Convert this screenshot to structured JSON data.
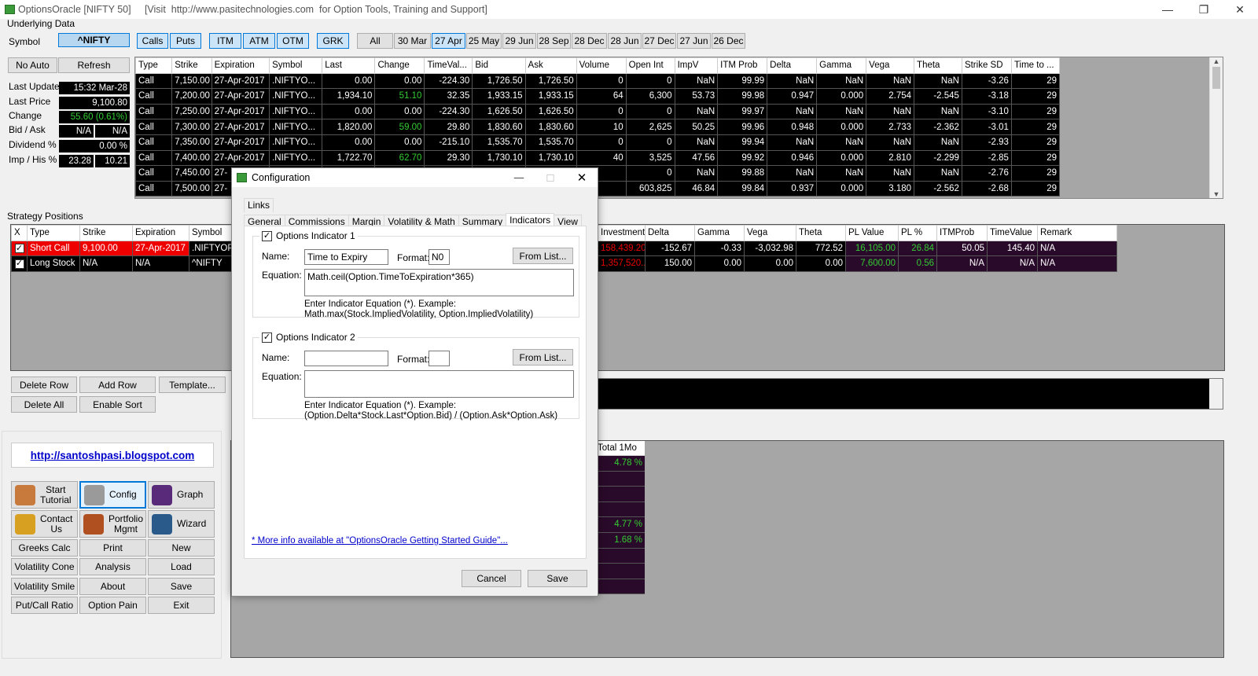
{
  "window": {
    "title": "OptionsOracle [NIFTY 50]     [Visit  http://www.pasitechnologies.com  for Option Tools, Training and Support]",
    "minimize": "—",
    "maximize": "❐",
    "close": "✕"
  },
  "underlying": {
    "section_title": "Underlying Data",
    "symbol_label": "Symbol",
    "symbol_value": "^NIFTY",
    "no_auto": "No Auto",
    "refresh": "Refresh",
    "fields": [
      {
        "label": "Last Update",
        "value": "15:32 Mar-28"
      },
      {
        "label": "Last Price",
        "value": "9,100.80"
      },
      {
        "label": "Change",
        "value": "55.60 (0.61%)"
      },
      {
        "label": "Bid / Ask",
        "value": "N/A",
        "value2": "N/A"
      },
      {
        "label": "Dividend %",
        "value": "0.00 %"
      },
      {
        "label": "Imp / His %",
        "value": "23.28",
        "value2": "10.21"
      }
    ]
  },
  "filters": {
    "calls": "Calls",
    "puts": "Puts",
    "itm": "ITM",
    "atm": "ATM",
    "otm": "OTM",
    "grk": "GRK",
    "dates": [
      "All",
      "30 Mar",
      "27 Apr",
      "25 May",
      "29 Jun",
      "28 Sep",
      "28 Dec",
      "28 Jun",
      "27 Dec",
      "27 Jun",
      "26 Dec"
    ]
  },
  "options_table": {
    "headers": [
      "Type",
      "Strike",
      "Expiration",
      "Symbol",
      "Last",
      "Change",
      "TimeVal...",
      "Bid",
      "Ask",
      "Volume",
      "Open Int",
      "ImpV",
      "ITM Prob",
      "Delta",
      "Gamma",
      "Vega",
      "Theta",
      "Strike SD",
      "Time to ..."
    ],
    "rows": [
      [
        "Call",
        "7,150.00",
        "27-Apr-2017",
        ".NIFTYO...",
        "0.00",
        "0.00",
        "-224.30",
        "1,726.50",
        "1,726.50",
        "0",
        "0",
        "NaN",
        "99.99",
        "NaN",
        "NaN",
        "NaN",
        "NaN",
        "-3.26",
        "29"
      ],
      [
        "Call",
        "7,200.00",
        "27-Apr-2017",
        ".NIFTYO...",
        "1,934.10",
        "51.10",
        "32.35",
        "1,933.15",
        "1,933.15",
        "64",
        "6,300",
        "53.73",
        "99.98",
        "0.947",
        "0.000",
        "2.754",
        "-2.545",
        "-3.18",
        "29"
      ],
      [
        "Call",
        "7,250.00",
        "27-Apr-2017",
        ".NIFTYO...",
        "0.00",
        "0.00",
        "-224.30",
        "1,626.50",
        "1,626.50",
        "0",
        "0",
        "NaN",
        "99.97",
        "NaN",
        "NaN",
        "NaN",
        "NaN",
        "-3.10",
        "29"
      ],
      [
        "Call",
        "7,300.00",
        "27-Apr-2017",
        ".NIFTYO...",
        "1,820.00",
        "59.00",
        "29.80",
        "1,830.60",
        "1,830.60",
        "10",
        "2,625",
        "50.25",
        "99.96",
        "0.948",
        "0.000",
        "2.733",
        "-2.362",
        "-3.01",
        "29"
      ],
      [
        "Call",
        "7,350.00",
        "27-Apr-2017",
        ".NIFTYO...",
        "0.00",
        "0.00",
        "-215.10",
        "1,535.70",
        "1,535.70",
        "0",
        "0",
        "NaN",
        "99.94",
        "NaN",
        "NaN",
        "NaN",
        "NaN",
        "-2.93",
        "29"
      ],
      [
        "Call",
        "7,400.00",
        "27-Apr-2017",
        ".NIFTYO...",
        "1,722.70",
        "62.70",
        "29.30",
        "1,730.10",
        "1,730.10",
        "40",
        "3,525",
        "47.56",
        "99.92",
        "0.946",
        "0.000",
        "2.810",
        "-2.299",
        "-2.85",
        "29"
      ],
      [
        "Call",
        "7,450.00",
        "27-",
        "",
        "",
        "",
        "",
        "",
        "",
        "",
        "0",
        "NaN",
        "99.88",
        "NaN",
        "NaN",
        "NaN",
        "NaN",
        "-2.76",
        "29"
      ],
      [
        "Call",
        "7,500.00",
        "27-",
        "",
        "",
        "",
        "",
        "",
        "",
        "",
        "603,825",
        "46.84",
        "99.84",
        "0.937",
        "0.000",
        "3.180",
        "-2.562",
        "-2.68",
        "29"
      ]
    ]
  },
  "strategy": {
    "section_title": "Strategy Positions",
    "left_headers": [
      "X",
      "Type",
      "Strike",
      "Expiration",
      "Symbol"
    ],
    "left_rows": [
      [
        "Short Call",
        "9,100.00",
        "27-Apr-2017",
        ".NIFTYOP..."
      ],
      [
        "Long Stock",
        "N/A",
        "N/A",
        "^NIFTY"
      ]
    ],
    "right_headers": [
      "Investment",
      "Delta",
      "Gamma",
      "Vega",
      "Theta",
      "PL Value",
      "PL %",
      "ITMProb",
      "TimeValue",
      "Remark"
    ],
    "right_rows": [
      [
        "158,439.20",
        "-152.67",
        "-0.33",
        "-3,032.98",
        "772.52",
        "16,105.00",
        "26.84",
        "50.05",
        "145.40",
        "N/A"
      ],
      [
        "1,357,520...",
        "150.00",
        "0.00",
        "0.00",
        "0.00",
        "7,600.00",
        "0.56",
        "N/A",
        "N/A",
        "N/A"
      ]
    ],
    "delete_row": "Delete Row",
    "add_row": "Add Row",
    "template": "Template...",
    "delete_all": "Delete All",
    "enable_sort": "Enable Sort"
  },
  "summary": {
    "header": "Total 1Mo",
    "values": [
      "4.78 %",
      "",
      "",
      "",
      "4.77 %",
      "1.68 %",
      "",
      "",
      ""
    ]
  },
  "side": {
    "link": "http://santoshpasi.blogspot.com",
    "big_buttons": [
      [
        "Start",
        "Tutorial"
      ],
      [
        "Config",
        ""
      ],
      [
        "Graph",
        ""
      ],
      [
        "Contact",
        "Us"
      ],
      [
        "Portfolio",
        "Mgmt"
      ],
      [
        "Wizard",
        ""
      ]
    ],
    "small_buttons": [
      "Greeks Calc",
      "Print",
      "New",
      "Volatility Cone",
      "Analysis",
      "Load",
      "Volatility Smile",
      "About",
      "Save",
      "Put/Call Ratio",
      "Option Pain",
      "Exit"
    ]
  },
  "dialog": {
    "title": "Configuration",
    "close": "✕",
    "restore": "☐",
    "minimize": "—",
    "tabs_top": [
      "Links"
    ],
    "tabs": [
      "General",
      "Commissions",
      "Margin",
      "Volatility & Math",
      "Summary",
      "Indicators",
      "View"
    ],
    "ind1": {
      "title": "Options Indicator 1",
      "name_label": "Name:",
      "name_value": "Time to Expiry",
      "format_label": "Format:",
      "format_value": "N0",
      "from_list": "From List...",
      "eq_label": "Equation:",
      "eq_value": "Math.ceil(Option.TimeToExpiration*365)",
      "hint1": "Enter Indicator Equation (*). Example:",
      "hint2": "Math.max(Stock.ImpliedVolatility, Option.ImpliedVolatility)"
    },
    "ind2": {
      "title": "Options Indicator 2",
      "name_label": "Name:",
      "name_value": "",
      "format_label": "Format:",
      "format_value": "",
      "from_list": "From List...",
      "eq_label": "Equation:",
      "eq_value": "",
      "hint1": "Enter Indicator Equation (*). Example:",
      "hint2": "(Option.Delta*Stock.Last*Option.Bid) / (Option.Ask*Option.Ask)"
    },
    "more_info": "* More info available at \"OptionsOracle Getting Started Guide\"...",
    "cancel": "Cancel",
    "save": "Save"
  }
}
